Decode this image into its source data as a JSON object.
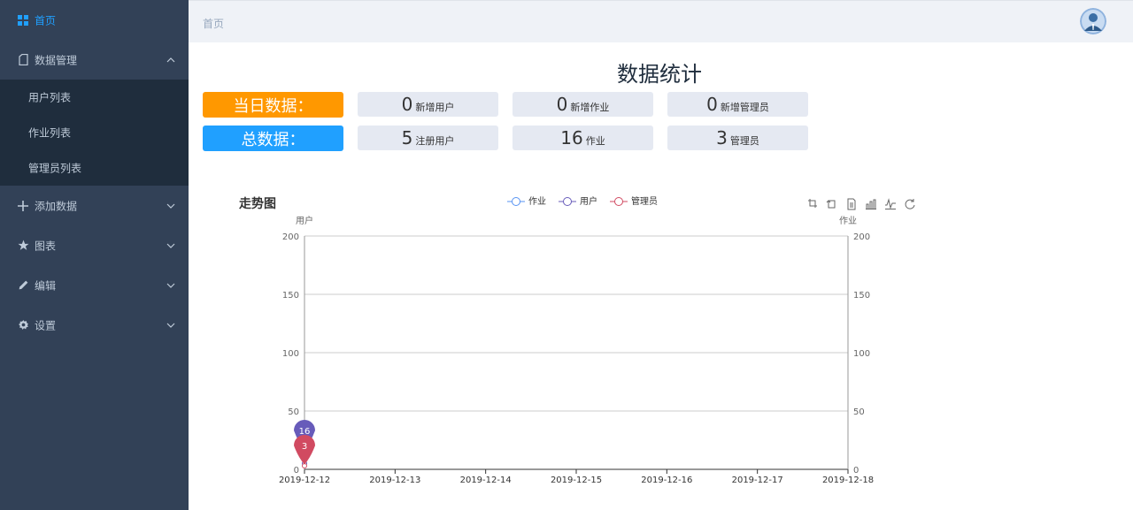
{
  "sidebar": {
    "items": [
      {
        "label": "首页",
        "icon": "grid-icon",
        "active": true
      },
      {
        "label": "数据管理",
        "icon": "document-icon",
        "expanded": true,
        "children": [
          {
            "label": "用户列表"
          },
          {
            "label": "作业列表"
          },
          {
            "label": "管理员列表"
          }
        ]
      },
      {
        "label": "添加数据",
        "icon": "plus-icon"
      },
      {
        "label": "图表",
        "icon": "star-icon"
      },
      {
        "label": "编辑",
        "icon": "pencil-icon"
      },
      {
        "label": "设置",
        "icon": "gear-icon"
      }
    ]
  },
  "header": {
    "breadcrumb": "首页",
    "avatar_icon": "user-avatar-icon"
  },
  "stats": {
    "title": "数据统计",
    "today": {
      "label": "当日数据：",
      "color": "#ff9800",
      "boxes": [
        {
          "num": "0",
          "text": "新增用户"
        },
        {
          "num": "0",
          "text": "新增作业"
        },
        {
          "num": "0",
          "text": "新增管理员"
        }
      ]
    },
    "total": {
      "label": "总数据：",
      "color": "#20a0ff",
      "boxes": [
        {
          "num": "5",
          "text": "注册用户"
        },
        {
          "num": "16",
          "text": "作业"
        },
        {
          "num": "3",
          "text": "管理员"
        }
      ]
    }
  },
  "chart_data": {
    "type": "line",
    "title": "走势图",
    "categories": [
      "2019-12-12",
      "2019-12-13",
      "2019-12-14",
      "2019-12-15",
      "2019-12-16",
      "2019-12-17",
      "2019-12-18"
    ],
    "y_left_label": "用户",
    "y_right_label": "作业",
    "ylim": [
      0,
      200
    ],
    "yticks": [
      0,
      50,
      100,
      150,
      200
    ],
    "grid": true,
    "legend_position": "top-center",
    "series": [
      {
        "name": "作业",
        "color": "#5793f3",
        "values": [
          16,
          null,
          null,
          null,
          null,
          null,
          null
        ]
      },
      {
        "name": "用户",
        "color": "#675bba",
        "values": [
          5,
          null,
          null,
          null,
          null,
          null,
          null
        ]
      },
      {
        "name": "管理员",
        "color": "#d14a61",
        "values": [
          3,
          null,
          null,
          null,
          null,
          null,
          null
        ]
      }
    ],
    "markers": [
      {
        "series": "用户",
        "value": "16",
        "color": "#675bba"
      },
      {
        "series": "管理员",
        "value": "3",
        "color": "#d14a61"
      }
    ],
    "toolbox": [
      "zoom-icon",
      "zoom-reset-icon",
      "data-view-icon",
      "bar-chart-icon",
      "line-chart-icon",
      "restore-icon"
    ]
  }
}
